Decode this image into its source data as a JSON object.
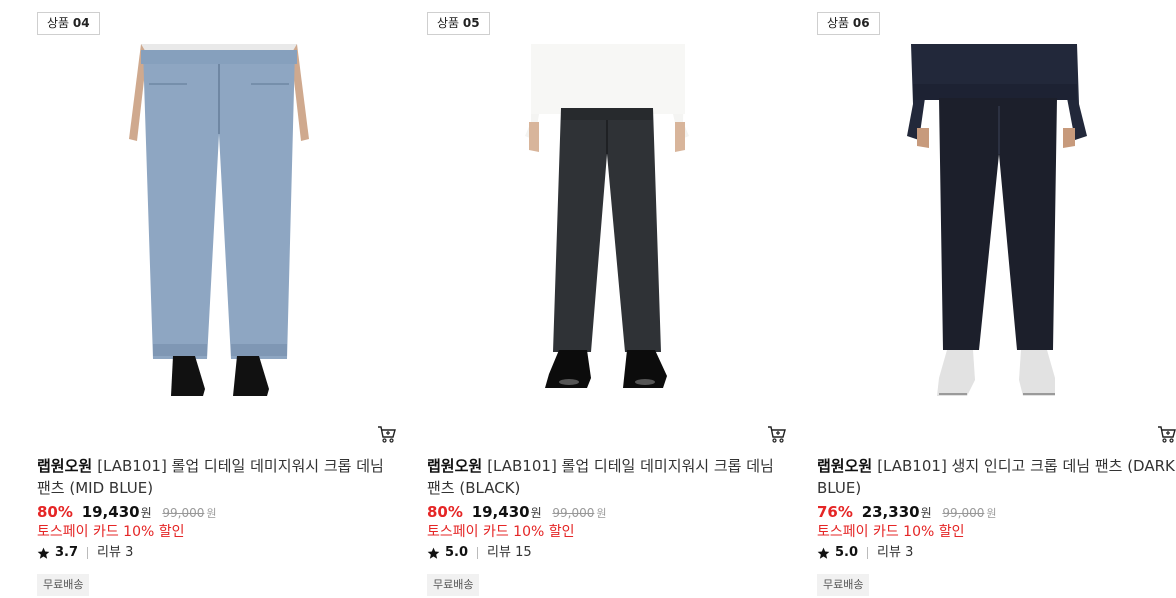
{
  "products": [
    {
      "badge_prefix": "상품",
      "badge_num": "04",
      "brand": "랩원오원",
      "name": "[LAB101] 롤업 디테일 데미지워시 크롭 데님 팬츠 (MID BLUE)",
      "discount": "80%",
      "price": "19,430",
      "won": "원",
      "original_price": "99,000",
      "original_won": "원",
      "promo": "토스페이 카드 10% 할인",
      "rating": "3.7",
      "reviews": "리뷰 3",
      "shipping": "무료배송",
      "jean_color": "#8ea6c2"
    },
    {
      "badge_prefix": "상품",
      "badge_num": "05",
      "brand": "랩원오원",
      "name": "[LAB101] 롤업 디테일 데미지워시 크롭 데님 팬츠 (BLACK)",
      "discount": "80%",
      "price": "19,430",
      "won": "원",
      "original_price": "99,000",
      "original_won": "원",
      "promo": "토스페이 카드 10% 할인",
      "rating": "5.0",
      "reviews": "리뷰 15",
      "shipping": "무료배송",
      "jean_color": "#2f3236"
    },
    {
      "badge_prefix": "상품",
      "badge_num": "06",
      "brand": "랩원오원",
      "name": "[LAB101] 생지 인디고 크롭 데님 팬츠 (DARK BLUE)",
      "discount": "76%",
      "price": "23,330",
      "won": "원",
      "original_price": "99,000",
      "original_won": "원",
      "promo": "토스페이 카드 10% 할인",
      "rating": "5.0",
      "reviews": "리뷰 3",
      "shipping": "무료배송",
      "jean_color": "#1c1f2b"
    }
  ]
}
